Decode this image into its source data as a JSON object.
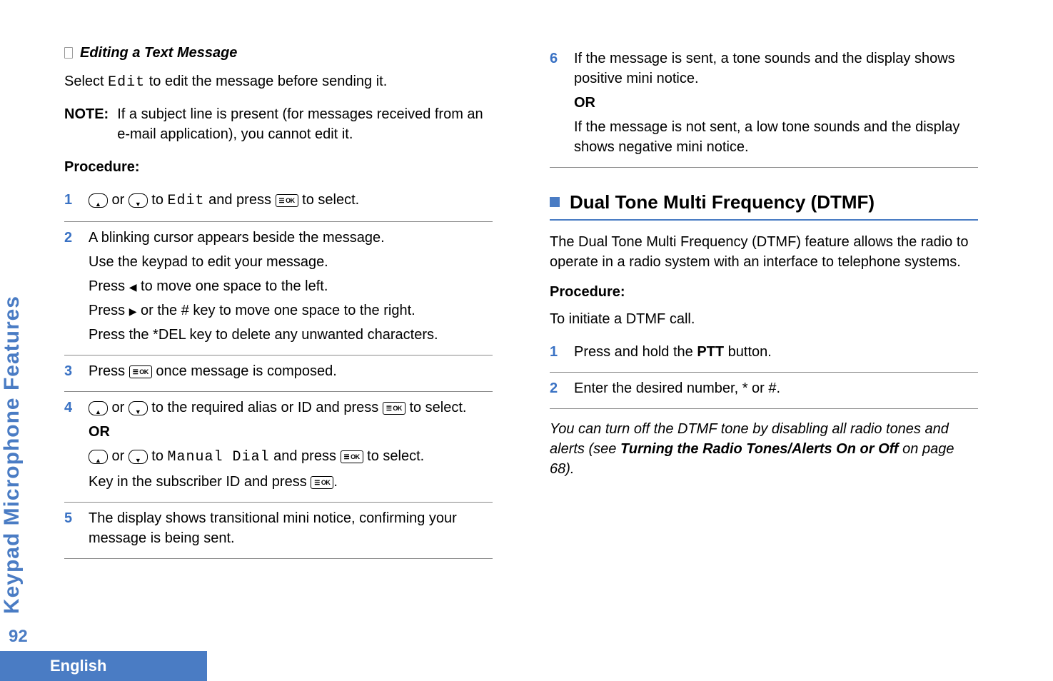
{
  "sidebar": {
    "label": "Keypad Microphone Features"
  },
  "left": {
    "subheading": "Editing a Text Message",
    "intro_pre": "Select ",
    "intro_mono": "Edit",
    "intro_post": " to edit the message before sending it.",
    "note_label": "NOTE:",
    "note_text": "If a subject line is present (for messages received from an e-mail application), you cannot edit it.",
    "procedure": "Procedure:",
    "step1_mid": " to ",
    "step1_mono": "Edit",
    "step1_mid2": " and press ",
    "step1_end": " to select.",
    "step2_l1": "A blinking cursor appears beside the message.",
    "step2_l2": "Use the keypad to edit your message.",
    "step2_l3a": "Press ",
    "step2_l3b": " to move one space to the left.",
    "step2_l4a": "Press ",
    "step2_l4b": " or the # key to move one space to the right.",
    "step2_l5": "Press the *DEL key to delete any unwanted characters.",
    "step3_a": "Press ",
    "step3_b": " once message is composed.",
    "step4_a": " to the required alias or ID and press ",
    "step4_b": " to select.",
    "step4_or": "OR",
    "step4_c": " to ",
    "step4_mono": "Manual Dial",
    "step4_d": " and press ",
    "step4_e": " to select.",
    "step4_f": "Key in the subscriber ID and press ",
    "step4_g": ".",
    "step5": "The display shows transitional mini notice, confirming your message is being sent.",
    "or_word": " or "
  },
  "right": {
    "step6_l1": "If the message is sent, a tone sounds and the display shows positive mini notice.",
    "step6_or": "OR",
    "step6_l2": "If the message is not sent, a low tone sounds and the display shows negative mini notice.",
    "section_title": "Dual Tone Multi Frequency (DTMF)",
    "dtmf_intro": "The Dual Tone Multi Frequency (DTMF) feature allows the radio to operate in a radio system with an interface to telephone systems.",
    "procedure": "Procedure:",
    "dtmf_sub": "To initiate a DTMF call.",
    "d1_a": "Press and hold the ",
    "d1_b": "PTT",
    "d1_c": " button.",
    "d2": "Enter the desired number, * or #.",
    "footnote_a": "You can turn off the DTMF tone by disabling all radio tones and alerts (see ",
    "footnote_b": "Turning the Radio Tones/Alerts On or Off",
    "footnote_c": " on page 68)."
  },
  "footer": {
    "page": "92",
    "lang": "English"
  },
  "nums": {
    "n1": "1",
    "n2": "2",
    "n3": "3",
    "n4": "4",
    "n5": "5",
    "n6": "6"
  }
}
